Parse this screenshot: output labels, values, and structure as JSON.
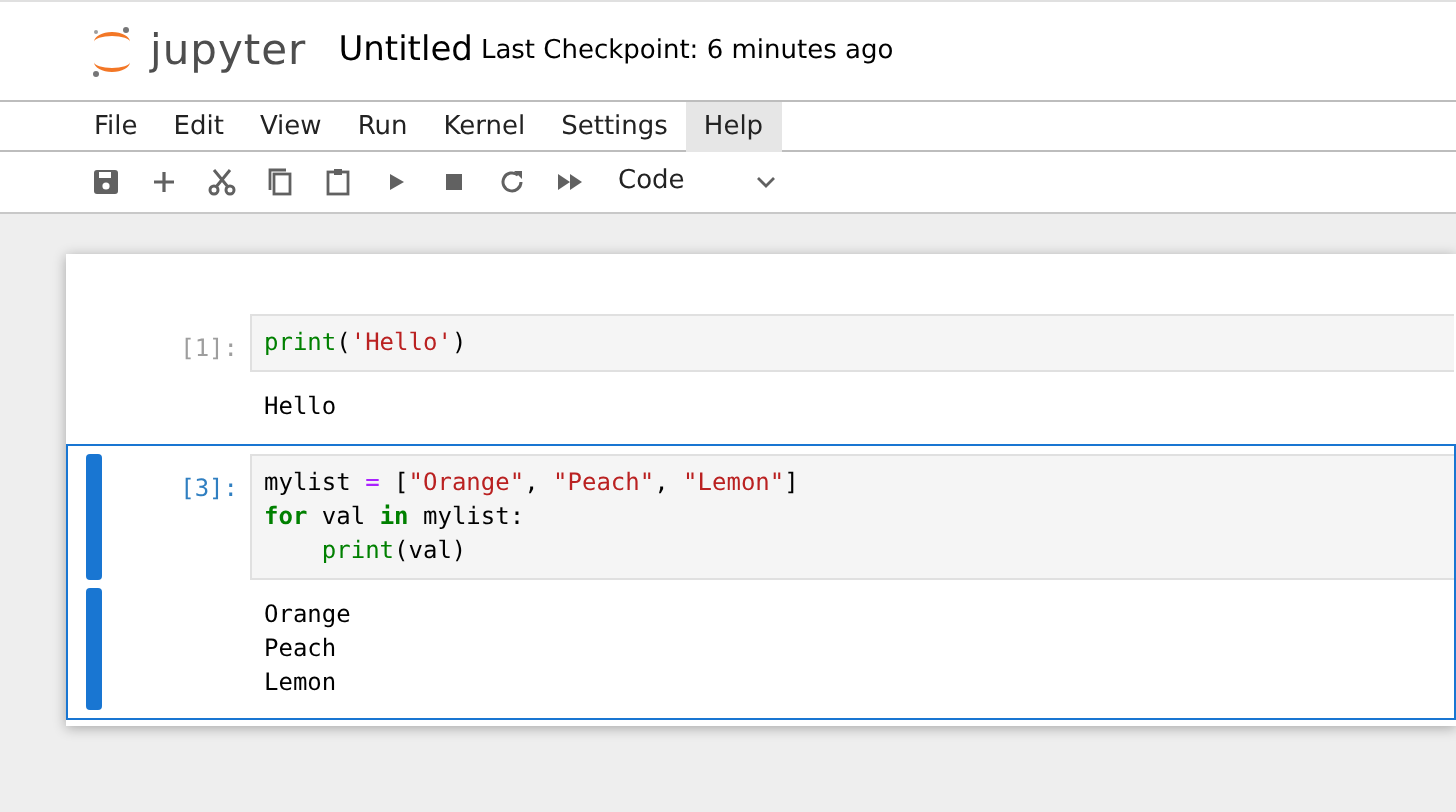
{
  "header": {
    "logo_text": "jupyter",
    "notebook_title": "Untitled",
    "checkpoint": "Last Checkpoint: 6 minutes ago"
  },
  "menu": [
    {
      "label": "File",
      "selected": false
    },
    {
      "label": "Edit",
      "selected": false
    },
    {
      "label": "View",
      "selected": false
    },
    {
      "label": "Run",
      "selected": false
    },
    {
      "label": "Kernel",
      "selected": false
    },
    {
      "label": "Settings",
      "selected": false
    },
    {
      "label": "Help",
      "selected": true
    }
  ],
  "toolbar": {
    "buttons": [
      {
        "kind": "save"
      },
      {
        "kind": "add"
      },
      {
        "kind": "cut"
      },
      {
        "kind": "copy"
      },
      {
        "kind": "paste"
      },
      {
        "kind": "run"
      },
      {
        "kind": "stop"
      },
      {
        "kind": "restart"
      },
      {
        "kind": "run-all"
      }
    ],
    "cell_type": "Code"
  },
  "cells": [
    {
      "prompt": "[1]:",
      "selected": false,
      "code": [
        [
          {
            "text": "print",
            "kind": "builtin"
          },
          {
            "text": "(",
            "kind": "plain"
          },
          {
            "text": "'Hello'",
            "kind": "string"
          },
          {
            "text": ")",
            "kind": "plain"
          }
        ]
      ],
      "output": [
        "Hello"
      ]
    },
    {
      "prompt": "[3]:",
      "selected": true,
      "code": [
        [
          {
            "text": "mylist ",
            "kind": "plain"
          },
          {
            "text": "=",
            "kind": "op"
          },
          {
            "text": " [",
            "kind": "plain"
          },
          {
            "text": "\"Orange\"",
            "kind": "string"
          },
          {
            "text": ", ",
            "kind": "plain"
          },
          {
            "text": "\"Peach\"",
            "kind": "string"
          },
          {
            "text": ", ",
            "kind": "plain"
          },
          {
            "text": "\"Lemon\"",
            "kind": "string"
          },
          {
            "text": "]",
            "kind": "plain"
          }
        ],
        [
          {
            "text": "for",
            "kind": "keyword"
          },
          {
            "text": " val ",
            "kind": "plain"
          },
          {
            "text": "in",
            "kind": "keyword"
          },
          {
            "text": " mylist:",
            "kind": "plain"
          }
        ],
        [
          {
            "text": "    print",
            "kind": "builtin"
          },
          {
            "text": "(val)",
            "kind": "plain"
          }
        ]
      ],
      "output": [
        "Orange",
        "Peach",
        "Lemon"
      ]
    }
  ]
}
